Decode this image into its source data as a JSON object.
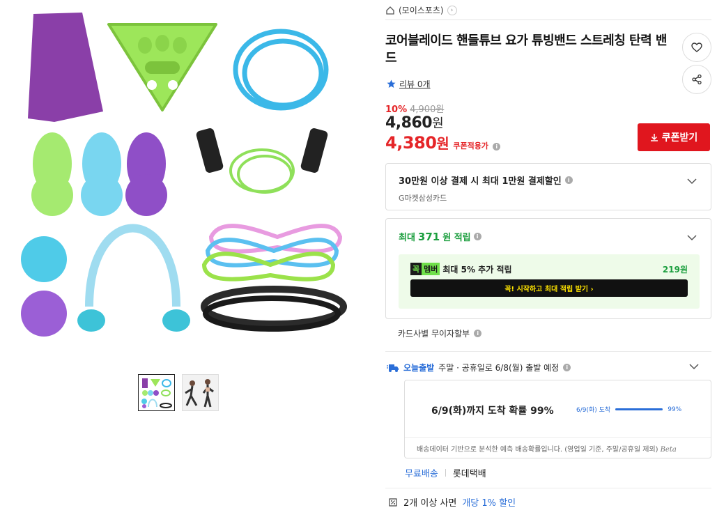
{
  "breadcrumb": {
    "shop_name": "(모이스포츠)"
  },
  "product": {
    "title": "코어블레이드 핸들튜브 요가 튜빙밴드 스트레칭 탄력 밴드",
    "review_label": "리뷰 0개"
  },
  "price": {
    "discount_pct": "10%",
    "original": "4,900원",
    "sale_number": "4,860",
    "sale_unit": "원",
    "coupon_number": "4,380",
    "coupon_unit": "원",
    "coupon_label": "쿠폰적용가",
    "coupon_button": "쿠폰받기"
  },
  "card_discount": {
    "title": "30만원 이상 결제 시 최대 1만원 결제할인",
    "card_name": "G마켓삼성카드"
  },
  "points": {
    "prefix": "최대",
    "amount": "371",
    "suffix": "원 적립",
    "member_logo_a": "꼭",
    "member_logo_b": "멤버",
    "member_text": "최대 5% 추가 적립",
    "member_amount": "219원",
    "member_button": "꼭! 시작하고 최대 적립 받기  ›"
  },
  "installment": {
    "label": "카드사별 무이자할부"
  },
  "shipping": {
    "badge": "오늘출발",
    "text": "주말 · 공휴일로 6/8(월) 출발 예정",
    "arrival_main": "6/9(화)까지 도착 확률 99%",
    "arrival_date_label": "6/9(화) 도착",
    "arrival_percent_label": "99%",
    "arrival_probability": 0.99,
    "note": "배송데이터 기반으로 분석한 예측 배송확률입니다. (영업일 기준, 주말/공휴일 제외)",
    "beta": "Beta",
    "free_label": "무료배송",
    "carrier": "롯데택배"
  },
  "bulk": {
    "text": "2개 이상 사면",
    "highlight": "개당 1% 할인"
  },
  "colors": {
    "accent_red": "#e52528",
    "point_green": "#1b9e3e",
    "link_blue": "#2a6ed8"
  }
}
